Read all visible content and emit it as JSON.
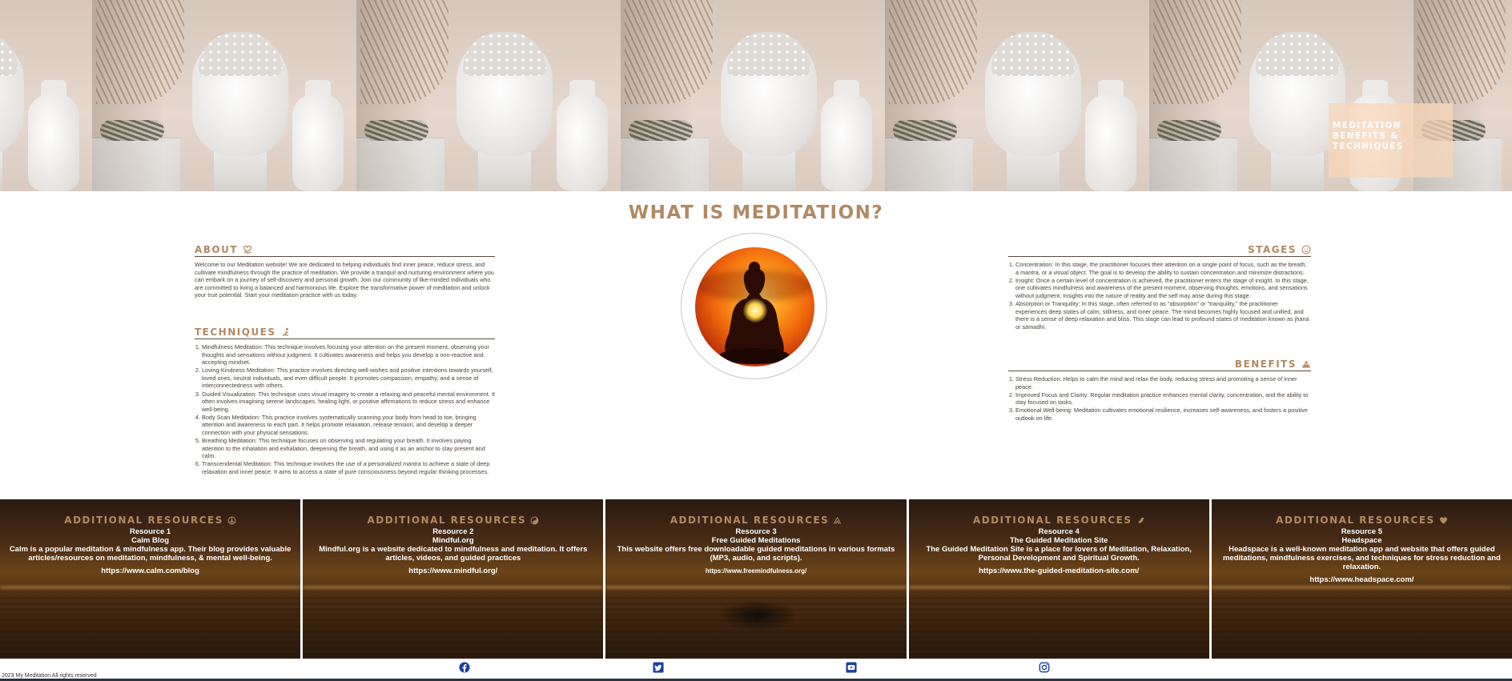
{
  "hero": {
    "line1": "MEDITATION",
    "line2": "BENEFITS & TECHNIQUES"
  },
  "main": {
    "title": "WHAT IS MEDITATION?"
  },
  "about": {
    "heading": "ABOUT",
    "icon": "hand-heart-icon",
    "text": "Welcome to our Meditation website! We are dedicated to helping individuals find inner peace, reduce stress, and cultivate mindfulness through the practice of meditation. We provide a tranquil and nurturing environment where you can embark on a journey of self-discovery and personal growth. Join our community of like-minded individuals who are committed to living a balanced and harmonious life. Explore the transformative power of meditation and unlock your true potential. Start your meditation practice with us today."
  },
  "techniques": {
    "heading": "TECHNIQUES",
    "icon": "meditation-pose-icon",
    "items": [
      "Mindfulness Meditation: This technique involves focusing your attention on the present moment, observing your thoughts and sensations without judgment. It cultivates awareness and helps you develop a non-reactive and accepting mindset.",
      "Loving-Kindness Meditation: This practice involves directing well-wishes and positive intentions towards yourself, loved ones, neutral individuals, and even difficult people. It promotes compassion, empathy, and a sense of interconnectedness with others.",
      "Guided Visualization: This technique uses visual imagery to create a relaxing and peaceful mental environment. It often involves imagining serene landscapes, healing light, or positive affirmations to reduce stress and enhance well-being.",
      "Body Scan Meditation: This practice involves systematically scanning your body from head to toe, bringing attention and awareness to each part. It helps promote relaxation, release tension, and develop a deeper connection with your physical sensations.",
      "Breathing Meditation: This technique focuses on observing and regulating your breath. It involves paying attention to the inhalation and exhalation, deepening the breath, and using it as an anchor to stay present and calm.",
      "Transcendental Meditation: This technique involves the use of a personalized mantra to achieve a state of deep relaxation and inner peace. It aims to access a state of pure consciousness beyond regular thinking processes."
    ]
  },
  "stages": {
    "heading": "STAGES",
    "icon": "smiley-icon",
    "items": [
      "Concentration: In this stage, the practitioner focuses their attention on a single point of focus, such as the breath, a mantra, or a visual object. The goal is to develop the ability to sustain concentration and minimize distractions.",
      "Insight: Once a certain level of concentration is achieved, the practitioner enters the stage of insight. In this stage, one cultivates mindfulness and awareness of the present moment, observing thoughts, emotions, and sensations without judgment. Insights into the nature of reality and the self may arise during this stage.",
      "Absorption or Tranquility: In this stage, often referred to as \"absorption\" or \"tranquility,\" the practitioner experiences deep states of calm, stillness, and inner peace. The mind becomes highly focused and unified, and there is a sense of deep relaxation and bliss. This stage can lead to profound states of meditation known as jhana or samadhi."
    ]
  },
  "benefits": {
    "heading": "BENEFITS",
    "icon": "mountain-icon",
    "items": [
      "Stress Reduction: Helps to calm the mind and relax the body, reducing stress and promoting a sense of inner peace.",
      "Improved Focus and Clarity: Regular meditation practice enhances mental clarity, concentration, and the ability to stay focused on tasks.",
      "Emotional Well-being: Meditation cultivates emotional resilience, increases self-awareness, and fosters a positive outlook on life."
    ]
  },
  "resources": [
    {
      "heading": "ADDITIONAL RESOURCES",
      "icon": "peace-icon",
      "num": "Resource 1",
      "name": "Calm Blog",
      "desc": "Calm is a popular meditation & mindfulness app. Their blog provides valuable articles/resources on meditation, mindfulness, & mental well-being.",
      "url": "https://www.calm.com/blog"
    },
    {
      "heading": "ADDITIONAL RESOURCES",
      "icon": "yin-yang-icon",
      "num": "Resource 2",
      "name": "Mindful.org",
      "desc": "Mindful.org is a website dedicated to mindfulness and meditation. It offers articles, videos, and guided practices",
      "url": "https://www.mindful.org/"
    },
    {
      "heading": "ADDITIONAL RESOURCES",
      "icon": "pray-icon",
      "num": "Resource 3",
      "name": "Free Guided Meditations",
      "desc": "This website offers free downloadable guided meditations in various formats (MP3, audio, and scripts).",
      "url": "https://www.freemindfulness.org/"
    },
    {
      "heading": "ADDITIONAL RESOURCES",
      "icon": "dove-icon",
      "num": "Resource 4",
      "name": "The Guided Meditation Site",
      "desc": "The Guided Meditation Site is a place for lovers of Meditation, Relaxation, Personal Development and Spiritual Growth.",
      "url": "https://www.the-guided-meditation-site.com/"
    },
    {
      "heading": "ADDITIONAL RESOURCES",
      "icon": "heart-icon",
      "num": "Resource 5",
      "name": "Headspace",
      "desc": "Headspace is a well-known meditation app and website that offers guided meditations, mindfulness exercises, and techniques for stress reduction and relaxation.",
      "url": "https://www.headspace.com/"
    }
  ],
  "footer": {
    "copyright": "2023 My Meditation All rights reserved",
    "social": [
      "facebook-icon",
      "twitter-icon",
      "youtube-icon",
      "instagram-icon"
    ]
  },
  "colors": {
    "accent": "#b08a63",
    "badge": "#f7d7ba",
    "social": "#1d3f9c"
  }
}
